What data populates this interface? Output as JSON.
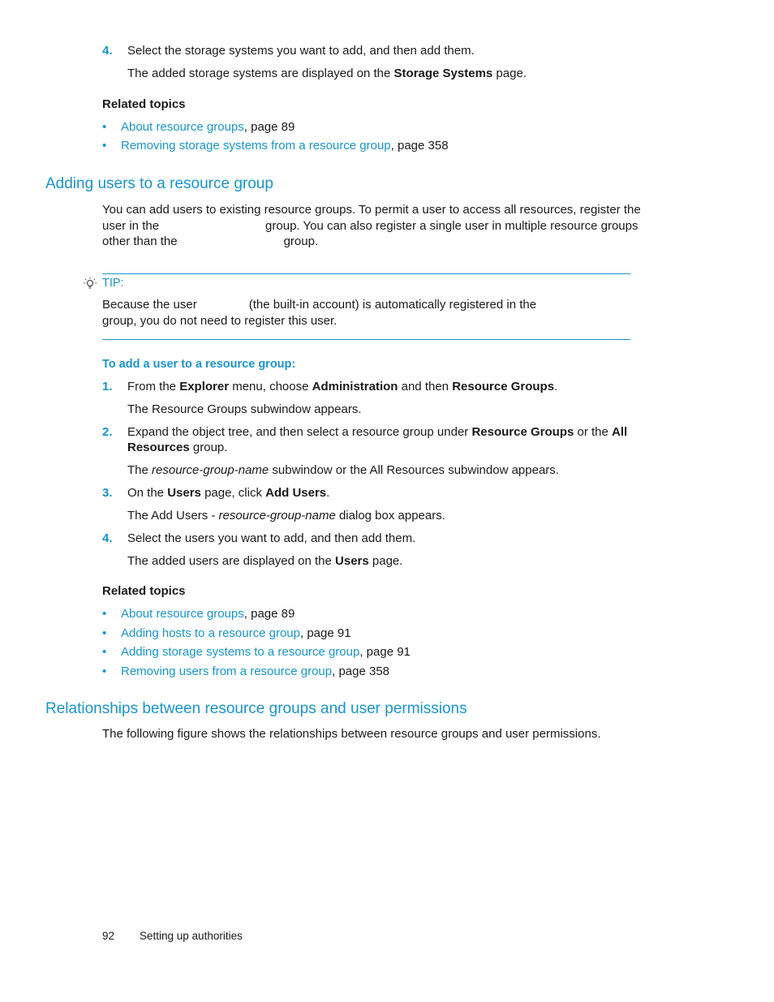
{
  "top_section": {
    "step4": {
      "number": "4.",
      "text": "Select the storage systems you want to add, and then add them.",
      "result_pre": "The added storage systems are displayed on the ",
      "result_bold": "Storage Systems",
      "result_post": " page."
    },
    "related_topics_heading": "Related topics",
    "related_topics": [
      {
        "link": "About resource groups",
        "suffix": ", page 89"
      },
      {
        "link": "Removing storage systems from a resource group",
        "suffix": ", page 358"
      }
    ]
  },
  "adding_users": {
    "heading": "Adding users to a resource group",
    "intro_line1": "You can add users to existing resource groups. To permit a user to access all resources, register the",
    "intro_line2a": "user in the",
    "intro_line2b": "group. You can also register a single user in multiple resource groups",
    "intro_line3a": "other than the",
    "intro_line3b": "group.",
    "tip": {
      "icon": "lightbulb-icon",
      "label": "TIP:",
      "line1a": "Because the user",
      "line1b": "(the built-in account) is automatically registered in the",
      "line2": "group, you do not need to register this user."
    },
    "procedure_title": "To add a user to a resource group:",
    "steps": [
      {
        "number": "1.",
        "parts": [
          {
            "t": "From the ",
            "s": "n"
          },
          {
            "t": "Explorer",
            "s": "b"
          },
          {
            "t": " menu, choose ",
            "s": "n"
          },
          {
            "t": "Administration",
            "s": "b"
          },
          {
            "t": " and then ",
            "s": "n"
          },
          {
            "t": "Resource Groups",
            "s": "b"
          },
          {
            "t": ".",
            "s": "n"
          }
        ],
        "result": "The Resource Groups subwindow appears."
      },
      {
        "number": "2.",
        "line1_pre": "Expand the object tree, and then select a resource group under ",
        "line1_bold": "Resource Groups",
        "line1_mid": " or the ",
        "line1_bold2": "All",
        "line2_bold": "Resources",
        "line2_post": " group.",
        "result_pre": "The ",
        "result_ital": "resource-group-name",
        "result_post": " subwindow or the All Resources subwindow appears."
      },
      {
        "number": "3.",
        "pre": "On the ",
        "bold1": "Users",
        "mid": " page, click ",
        "bold2": "Add Users",
        "post": ".",
        "result_pre": "The Add Users - ",
        "result_ital": "resource-group-name",
        "result_post": " dialog box appears."
      },
      {
        "number": "4.",
        "text": "Select the users you want to add, and then add them.",
        "result_pre": "The added users are displayed on the ",
        "result_bold": "Users",
        "result_post": " page."
      }
    ],
    "related_topics_heading": "Related topics",
    "related_topics": [
      {
        "link": "About resource groups",
        "suffix": ", page 89"
      },
      {
        "link": "Adding hosts to a resource group",
        "suffix": ", page 91"
      },
      {
        "link": "Adding storage systems to a resource group",
        "suffix": ", page 91"
      },
      {
        "link": "Removing users from a resource group",
        "suffix": ", page 358"
      }
    ]
  },
  "relationships": {
    "heading": "Relationships between resource groups and user permissions",
    "intro": "The following figure shows the relationships between resource groups and user permissions."
  },
  "footer": {
    "page_number": "92",
    "chapter": "Setting up authorities"
  }
}
